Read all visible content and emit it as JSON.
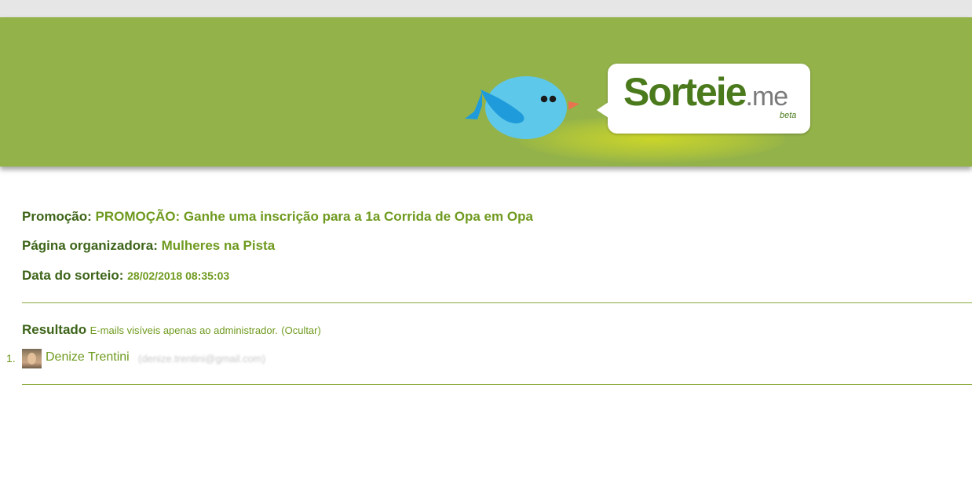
{
  "header": {
    "logo_main": "Sorteie",
    "logo_suffix": ".me",
    "logo_beta": "beta",
    "colors": {
      "header_bg": "#93b24a",
      "bird": "#5ec8ea",
      "wing": "#1f9bdc",
      "logo_green": "#4a7a1c"
    }
  },
  "info": {
    "promo_label": "Promoção:",
    "promo_value": "PROMOÇÃO: Ganhe uma inscrição para a 1a Corrida de Opa em Opa",
    "page_label": "Página organizadora:",
    "page_value": "Mulheres na Pista",
    "date_label": "Data do sorteio:",
    "date_value": "28/02/2018 08:35:03"
  },
  "result": {
    "title": "Resultado",
    "note": "E-mails visíveis apenas ao administrador.",
    "hide_link": "(Ocultar)",
    "winners": [
      {
        "number": "1.",
        "name": "Denize Trentini",
        "email": "(denize.trentini@gmail.com)"
      }
    ]
  }
}
